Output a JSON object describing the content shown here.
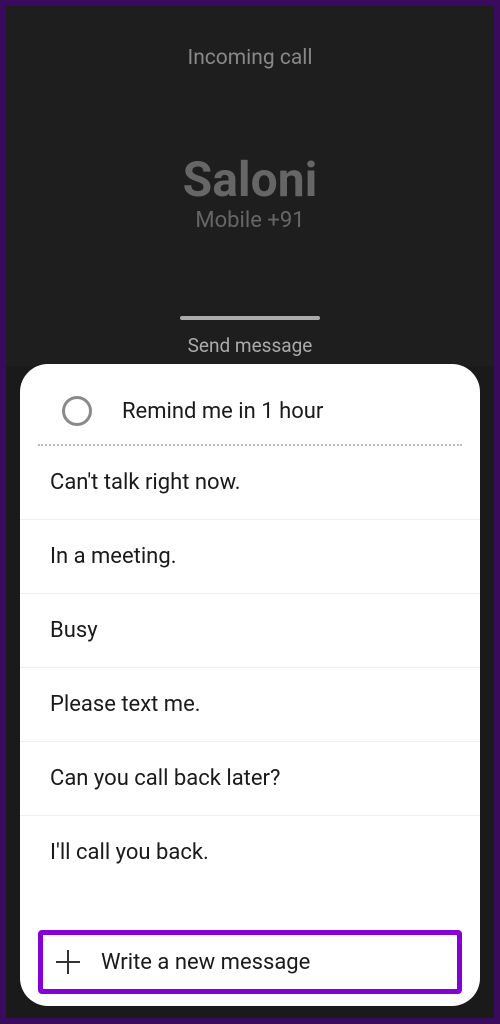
{
  "header": {
    "incoming_label": "Incoming call",
    "caller_name": "Saloni",
    "caller_number": "Mobile  +91"
  },
  "sheet": {
    "send_label": "Send message",
    "remind_label": "Remind me in 1 hour",
    "replies": [
      "Can't talk right now.",
      "In a meeting.",
      "Busy",
      "Please text me.",
      "Can you call back later?",
      "I'll call you back."
    ],
    "write_new": "Write a new message"
  }
}
